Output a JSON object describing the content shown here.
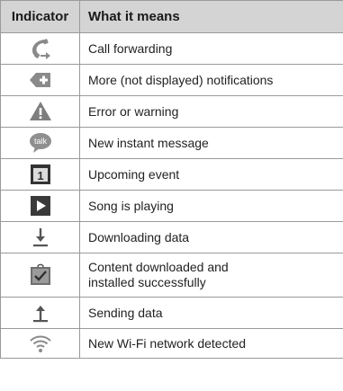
{
  "table": {
    "headers": {
      "indicator": "Indicator",
      "meaning": "What it means"
    },
    "rows": [
      {
        "icon": "call-forwarding-icon",
        "meaning": "Call forwarding"
      },
      {
        "icon": "more-notifications-icon",
        "meaning": "More (not displayed) notifications"
      },
      {
        "icon": "warning-icon",
        "meaning": "Error or warning"
      },
      {
        "icon": "talk-icon",
        "icon_text": "talk",
        "meaning": "New instant message"
      },
      {
        "icon": "calendar-event-icon",
        "icon_text": "1",
        "meaning": "Upcoming event"
      },
      {
        "icon": "play-icon",
        "meaning": "Song is playing"
      },
      {
        "icon": "download-icon",
        "meaning": "Downloading data"
      },
      {
        "icon": "installed-icon",
        "meaning": [
          "Content downloaded and",
          "installed successfully"
        ]
      },
      {
        "icon": "upload-icon",
        "meaning": "Sending data"
      },
      {
        "icon": "wifi-icon",
        "meaning": "New Wi-Fi network detected"
      }
    ]
  }
}
